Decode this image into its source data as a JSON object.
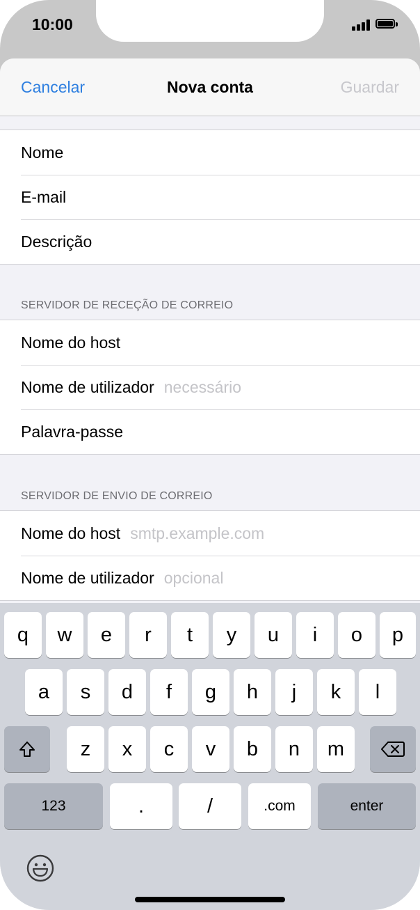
{
  "status_bar": {
    "time": "10:00"
  },
  "nav": {
    "cancel_label": "Cancelar",
    "title": "Nova conta",
    "save_label": "Guardar"
  },
  "account_group": {
    "rows": [
      {
        "label": "Nome",
        "placeholder": ""
      },
      {
        "label": "E-mail",
        "placeholder": ""
      },
      {
        "label": "Descrição",
        "placeholder": ""
      }
    ]
  },
  "incoming": {
    "header": "SERVIDOR DE RECEÇÃO DE CORREIO",
    "rows": [
      {
        "label": "Nome do host",
        "placeholder": ""
      },
      {
        "label": "Nome de utilizador",
        "placeholder": "necessário"
      },
      {
        "label": "Palavra-passe",
        "placeholder": ""
      }
    ]
  },
  "outgoing": {
    "header": "SERVIDOR DE ENVIO DE CORREIO",
    "rows": [
      {
        "label": "Nome do host",
        "placeholder": "smtp.example.com"
      },
      {
        "label": "Nome de utilizador",
        "placeholder": "opcional"
      }
    ]
  },
  "keyboard": {
    "row1": [
      "q",
      "w",
      "e",
      "r",
      "t",
      "y",
      "u",
      "i",
      "o",
      "p"
    ],
    "row2": [
      "a",
      "s",
      "d",
      "f",
      "g",
      "h",
      "j",
      "k",
      "l"
    ],
    "row3": [
      "z",
      "x",
      "c",
      "v",
      "b",
      "n",
      "m"
    ],
    "bottom": {
      "numbers": "123",
      "dot": ".",
      "slash": "/",
      "dotcom": ".com",
      "enter": "enter"
    }
  },
  "colors": {
    "accent": "#2e7fe0",
    "disabled": "#c7c7cc",
    "placeholder": "#c4c4c8",
    "keyboard_bg": "#d1d4db",
    "key_dark": "#aeb3bd"
  }
}
